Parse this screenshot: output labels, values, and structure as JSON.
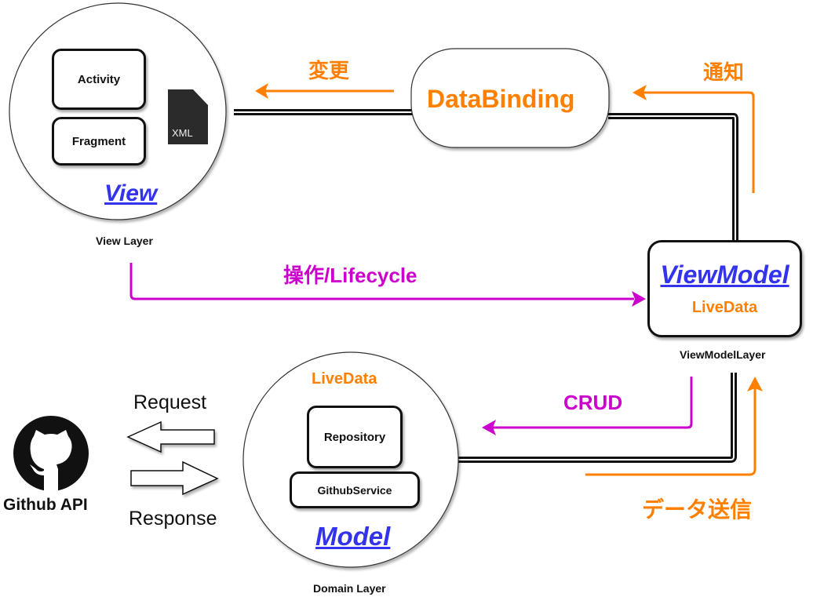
{
  "view": {
    "title": "View",
    "layer_label": "View Layer",
    "components": [
      "Activity",
      "Fragment"
    ],
    "xml_icon_label": "XML"
  },
  "databinding": {
    "title": "DataBinding"
  },
  "viewmodel": {
    "title": "ViewModel",
    "livedata": "LiveData",
    "layer_label": "ViewModelLayer"
  },
  "model": {
    "title": "Model",
    "livedata": "LiveData",
    "components": [
      "Repository",
      "GithubService"
    ],
    "layer_label": "Domain Layer"
  },
  "github": {
    "label": "Github API",
    "request": "Request",
    "response": "Response"
  },
  "arrows": {
    "change": "変更",
    "notify": "通知",
    "operation": "操作/Lifecycle",
    "crud": "CRUD",
    "data_send": "データ送信"
  },
  "colors": {
    "orange": "#ff8000",
    "magenta": "#cc00cc",
    "blue": "#3333ee",
    "black": "#111111"
  }
}
